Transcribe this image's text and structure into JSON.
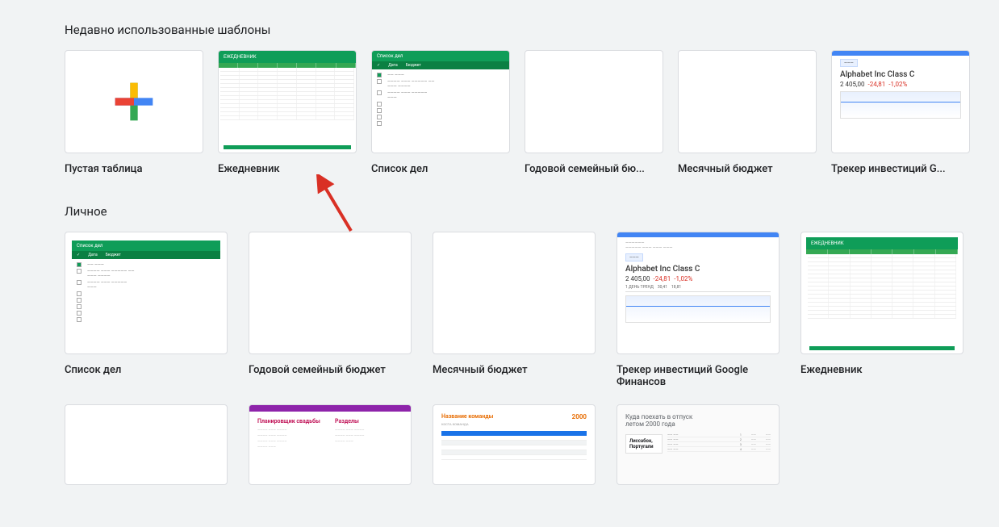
{
  "sections": {
    "recent_title": "Недавно использованные шаблоны",
    "personal_title": "Личное"
  },
  "recent": [
    {
      "label": "Пустая таблица"
    },
    {
      "label": "Ежедневник"
    },
    {
      "label": "Список дел"
    },
    {
      "label": "Годовой семейный бю..."
    },
    {
      "label": "Месячный бюджет"
    },
    {
      "label": "Трекер инвестиций G..."
    }
  ],
  "personal": [
    {
      "label": "Список дел"
    },
    {
      "label": "Годовой семейный бюджет"
    },
    {
      "label": "Месячный бюджет"
    },
    {
      "label": "Трекер инвестиций Google Финансов"
    },
    {
      "label": "Ежедневник"
    }
  ],
  "preview": {
    "todo_title": "Список дел",
    "todo_date": "Дата",
    "todo_budget": "Бюджет",
    "sched_title": "ЕЖЕДНЕВНИК",
    "finance_company": "Alphabet Inc Class C",
    "finance_price": "2 405,00",
    "finance_change1": "-24,81",
    "finance_change2": "-1,02%",
    "wed_h1": "Планировщик свадьбы",
    "wed_h2": "Разделы",
    "team_name": "Название команды",
    "team_year": "2000",
    "team_sub": "КОСТА КОМАНДА",
    "trv_h1": "Куда поехать в отпуск",
    "trv_h2": "летом 2000 года",
    "trv_city1": "Лиссабон,",
    "trv_city2": "Португали"
  }
}
